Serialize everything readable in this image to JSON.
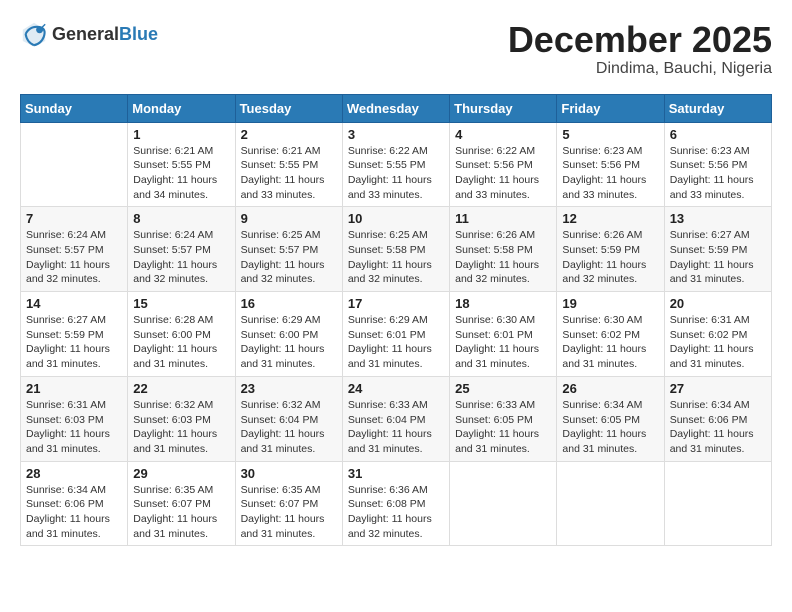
{
  "header": {
    "logo_general": "General",
    "logo_blue": "Blue",
    "title": "December 2025",
    "subtitle": "Dindima, Bauchi, Nigeria"
  },
  "calendar": {
    "days_of_week": [
      "Sunday",
      "Monday",
      "Tuesday",
      "Wednesday",
      "Thursday",
      "Friday",
      "Saturday"
    ],
    "weeks": [
      [
        {
          "day": "",
          "info": ""
        },
        {
          "day": "1",
          "info": "Sunrise: 6:21 AM\nSunset: 5:55 PM\nDaylight: 11 hours\nand 34 minutes."
        },
        {
          "day": "2",
          "info": "Sunrise: 6:21 AM\nSunset: 5:55 PM\nDaylight: 11 hours\nand 33 minutes."
        },
        {
          "day": "3",
          "info": "Sunrise: 6:22 AM\nSunset: 5:55 PM\nDaylight: 11 hours\nand 33 minutes."
        },
        {
          "day": "4",
          "info": "Sunrise: 6:22 AM\nSunset: 5:56 PM\nDaylight: 11 hours\nand 33 minutes."
        },
        {
          "day": "5",
          "info": "Sunrise: 6:23 AM\nSunset: 5:56 PM\nDaylight: 11 hours\nand 33 minutes."
        },
        {
          "day": "6",
          "info": "Sunrise: 6:23 AM\nSunset: 5:56 PM\nDaylight: 11 hours\nand 33 minutes."
        }
      ],
      [
        {
          "day": "7",
          "info": "Sunrise: 6:24 AM\nSunset: 5:57 PM\nDaylight: 11 hours\nand 32 minutes."
        },
        {
          "day": "8",
          "info": "Sunrise: 6:24 AM\nSunset: 5:57 PM\nDaylight: 11 hours\nand 32 minutes."
        },
        {
          "day": "9",
          "info": "Sunrise: 6:25 AM\nSunset: 5:57 PM\nDaylight: 11 hours\nand 32 minutes."
        },
        {
          "day": "10",
          "info": "Sunrise: 6:25 AM\nSunset: 5:58 PM\nDaylight: 11 hours\nand 32 minutes."
        },
        {
          "day": "11",
          "info": "Sunrise: 6:26 AM\nSunset: 5:58 PM\nDaylight: 11 hours\nand 32 minutes."
        },
        {
          "day": "12",
          "info": "Sunrise: 6:26 AM\nSunset: 5:59 PM\nDaylight: 11 hours\nand 32 minutes."
        },
        {
          "day": "13",
          "info": "Sunrise: 6:27 AM\nSunset: 5:59 PM\nDaylight: 11 hours\nand 31 minutes."
        }
      ],
      [
        {
          "day": "14",
          "info": "Sunrise: 6:27 AM\nSunset: 5:59 PM\nDaylight: 11 hours\nand 31 minutes."
        },
        {
          "day": "15",
          "info": "Sunrise: 6:28 AM\nSunset: 6:00 PM\nDaylight: 11 hours\nand 31 minutes."
        },
        {
          "day": "16",
          "info": "Sunrise: 6:29 AM\nSunset: 6:00 PM\nDaylight: 11 hours\nand 31 minutes."
        },
        {
          "day": "17",
          "info": "Sunrise: 6:29 AM\nSunset: 6:01 PM\nDaylight: 11 hours\nand 31 minutes."
        },
        {
          "day": "18",
          "info": "Sunrise: 6:30 AM\nSunset: 6:01 PM\nDaylight: 11 hours\nand 31 minutes."
        },
        {
          "day": "19",
          "info": "Sunrise: 6:30 AM\nSunset: 6:02 PM\nDaylight: 11 hours\nand 31 minutes."
        },
        {
          "day": "20",
          "info": "Sunrise: 6:31 AM\nSunset: 6:02 PM\nDaylight: 11 hours\nand 31 minutes."
        }
      ],
      [
        {
          "day": "21",
          "info": "Sunrise: 6:31 AM\nSunset: 6:03 PM\nDaylight: 11 hours\nand 31 minutes."
        },
        {
          "day": "22",
          "info": "Sunrise: 6:32 AM\nSunset: 6:03 PM\nDaylight: 11 hours\nand 31 minutes."
        },
        {
          "day": "23",
          "info": "Sunrise: 6:32 AM\nSunset: 6:04 PM\nDaylight: 11 hours\nand 31 minutes."
        },
        {
          "day": "24",
          "info": "Sunrise: 6:33 AM\nSunset: 6:04 PM\nDaylight: 11 hours\nand 31 minutes."
        },
        {
          "day": "25",
          "info": "Sunrise: 6:33 AM\nSunset: 6:05 PM\nDaylight: 11 hours\nand 31 minutes."
        },
        {
          "day": "26",
          "info": "Sunrise: 6:34 AM\nSunset: 6:05 PM\nDaylight: 11 hours\nand 31 minutes."
        },
        {
          "day": "27",
          "info": "Sunrise: 6:34 AM\nSunset: 6:06 PM\nDaylight: 11 hours\nand 31 minutes."
        }
      ],
      [
        {
          "day": "28",
          "info": "Sunrise: 6:34 AM\nSunset: 6:06 PM\nDaylight: 11 hours\nand 31 minutes."
        },
        {
          "day": "29",
          "info": "Sunrise: 6:35 AM\nSunset: 6:07 PM\nDaylight: 11 hours\nand 31 minutes."
        },
        {
          "day": "30",
          "info": "Sunrise: 6:35 AM\nSunset: 6:07 PM\nDaylight: 11 hours\nand 31 minutes."
        },
        {
          "day": "31",
          "info": "Sunrise: 6:36 AM\nSunset: 6:08 PM\nDaylight: 11 hours\nand 32 minutes."
        },
        {
          "day": "",
          "info": ""
        },
        {
          "day": "",
          "info": ""
        },
        {
          "day": "",
          "info": ""
        }
      ]
    ]
  }
}
